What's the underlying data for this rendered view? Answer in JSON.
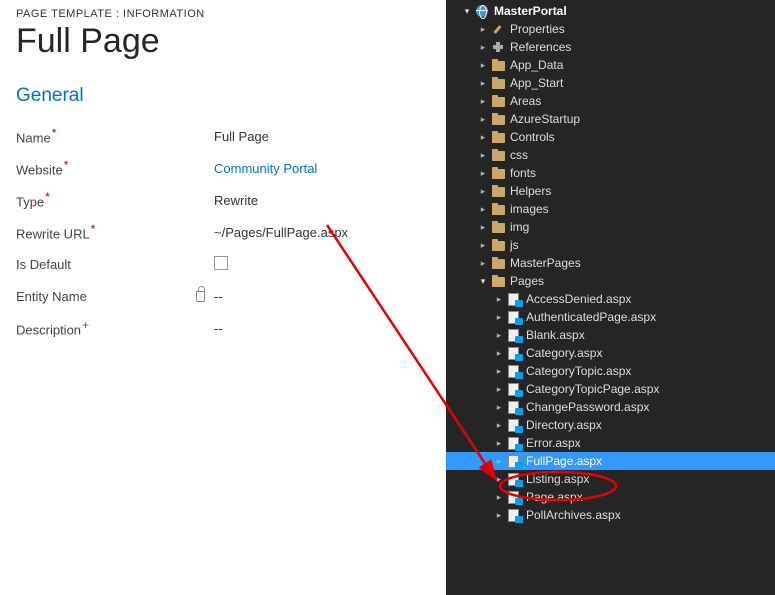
{
  "breadcrumb": "PAGE TEMPLATE : INFORMATION",
  "title": "Full Page",
  "section": "General",
  "form": {
    "name_label": "Name",
    "name_value": "Full Page",
    "website_label": "Website",
    "website_value": "Community Portal",
    "type_label": "Type",
    "type_value": "Rewrite",
    "rewriteurl_label": "Rewrite URL",
    "rewriteurl_value": "~/Pages/FullPage.aspx",
    "isdefault_label": "Is Default",
    "entityname_label": "Entity Name",
    "entityname_value": "--",
    "description_label": "Description",
    "description_value": "--"
  },
  "tree": {
    "project": "MasterPortal",
    "properties": "Properties",
    "references": "References",
    "folders": [
      "App_Data",
      "App_Start",
      "Areas",
      "AzureStartup",
      "Controls",
      "css",
      "fonts",
      "Helpers",
      "images",
      "img",
      "js",
      "MasterPages"
    ],
    "pages_folder": "Pages",
    "pages": [
      "AccessDenied.aspx",
      "AuthenticatedPage.aspx",
      "Blank.aspx",
      "Category.aspx",
      "CategoryTopic.aspx",
      "CategoryTopicPage.aspx",
      "ChangePassword.aspx",
      "Directory.aspx",
      "Error.aspx",
      "FullPage.aspx",
      "Listing.aspx",
      "Page.aspx",
      "PollArchives.aspx"
    ],
    "selected_page_index": 9
  }
}
